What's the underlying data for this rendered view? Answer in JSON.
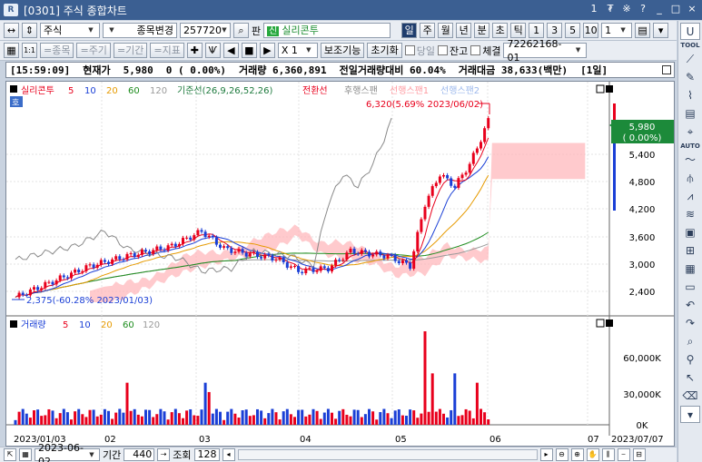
{
  "window": {
    "app_icon": "R",
    "title": "[0301] 주식 종합차트",
    "controls": [
      {
        "name": "window-number",
        "label": "1"
      },
      {
        "name": "pin-icon",
        "label": "₮"
      },
      {
        "name": "settings-icon",
        "label": "※"
      },
      {
        "name": "help-icon",
        "label": "?"
      },
      {
        "name": "minimize-icon",
        "label": "_"
      },
      {
        "name": "maximize-icon",
        "label": "□"
      },
      {
        "name": "close-icon",
        "label": "×"
      }
    ]
  },
  "toolbar1": {
    "market": "주식",
    "change_label": "종목변경",
    "code": "257720",
    "search_icon": "search-icon",
    "pan_label": "판",
    "credit_badge": "신",
    "stock_name": "실리콘투",
    "periods": [
      "일",
      "주",
      "월",
      "년",
      "분",
      "초",
      "틱"
    ],
    "active_period": "일",
    "numbers": [
      "1",
      "3",
      "5",
      "10",
      "1"
    ]
  },
  "toolbar2": {
    "grid_icon": "grid-icon",
    "one_to_one": "1:1",
    "stock_btn": "종목",
    "cycle_btn": "주기",
    "period_btn": "기간",
    "indicator_btn": "지표",
    "multiplier": "X 1",
    "aux_btn": "보조기능",
    "reset_btn": "초기화",
    "checkbox_today": "당일",
    "checkbox_balance": "잔고",
    "checkbox_exec": "체결",
    "account": "72262168-01"
  },
  "status": {
    "time": "[15:59:09]",
    "price_label": "현재가",
    "price": "5,980",
    "change": "0 ( 0.00%)",
    "volume_label": "거래량",
    "volume": "6,360,891",
    "prev_ratio_label": "전일거래량대비",
    "prev_ratio": "60.04%",
    "amount_label": "거래대금",
    "amount": "38,633(백만)",
    "unit": "[1일]"
  },
  "price_pane": {
    "legend": {
      "name": "실리콘투",
      "ma": [
        "5",
        "10",
        "20",
        "60",
        "120"
      ],
      "ichimoku": "기준선(26,9,26,52,26)",
      "conversion": "전환선",
      "lagging": "후행스팬",
      "span1": "선행스팬1",
      "span2": "선행스팬2"
    },
    "ho_label": "호",
    "high_note": "6,320(5.69% 2023/06/02)",
    "low_note": "2,375(-60.28% 2023/01/03)",
    "current_price": "5,980",
    "current_change": "( 0.00%)",
    "y_ticks": [
      "5,400",
      "4,800",
      "4,200",
      "3,600",
      "3,000",
      "2,400"
    ]
  },
  "volume_pane": {
    "legend": {
      "name": "거래량",
      "ma": [
        "5",
        "10",
        "20",
        "60",
        "120"
      ]
    },
    "y_ticks": [
      "60,000K",
      "30,000K",
      "0K"
    ]
  },
  "x_axis": [
    "2023/01/03",
    "02",
    "03",
    "04",
    "05",
    "06",
    "07",
    "2023/07/07"
  ],
  "colors": {
    "up": "#e8001c",
    "down": "#1a3fd6",
    "ma5": "#e8001c",
    "ma10": "#1a3fd6",
    "ma20": "#e69a00",
    "ma60": "#1d8c1d",
    "ma120": "#9a9a9a",
    "ichimoku_base": "#1d7a3d",
    "conversion": "#e8001c",
    "lagging": "#8a8a8a",
    "cloud": "#ffb3b8",
    "cloud2": "#b8cff5"
  },
  "bottom": {
    "date": "2023-06-02",
    "period_label": "기간",
    "period_value": "440",
    "view_label": "조회",
    "view_value": "128"
  },
  "side_tools": [
    "tool-text",
    "line-icon",
    "pencil-icon",
    "magnet-icon",
    "doc-icon",
    "cross-icon",
    "auto-label",
    "wave-icon",
    "fork-icon",
    "zigzag-icon",
    "stack-icon",
    "box-icon",
    "calc-icon",
    "grid-icon",
    "window-icon",
    "undo-icon",
    "redo-icon",
    "zoom-icon",
    "pin-icon",
    "cursor-icon",
    "eraser-icon"
  ]
}
